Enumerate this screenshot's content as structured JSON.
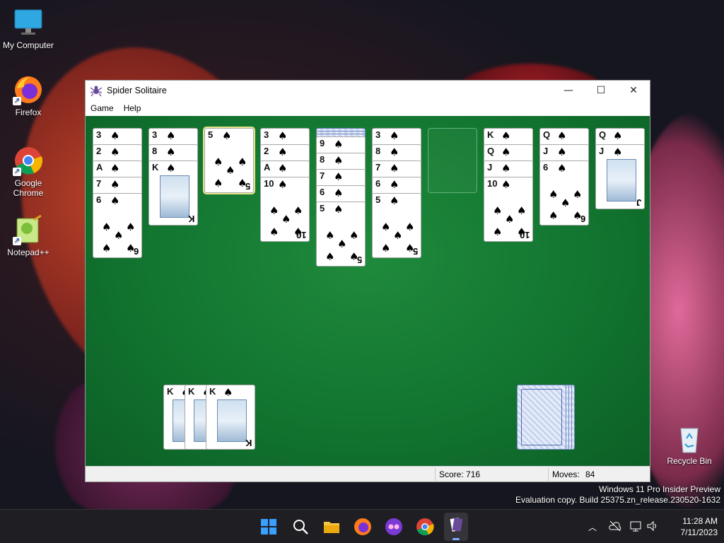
{
  "desktop": {
    "icons": [
      {
        "label": "My Computer"
      },
      {
        "label": "Firefox"
      },
      {
        "label": "Google Chrome"
      },
      {
        "label": "Notepad++"
      },
      {
        "label": "Recycle Bin"
      }
    ]
  },
  "window": {
    "title": "Spider Solitaire",
    "controls": {
      "minimize": "—",
      "maximize": "☐",
      "close": "✕"
    },
    "menu": [
      "Game",
      "Help"
    ],
    "status": {
      "score_label": "Score: 716",
      "moves_label": "Moves:",
      "moves_value": "84"
    }
  },
  "tableau": {
    "suit_symbol": "♠",
    "columns": [
      {
        "cards": [
          "3",
          "2",
          "A",
          "7",
          "6"
        ]
      },
      {
        "cards": [
          "3",
          "8",
          "K"
        ]
      },
      {
        "cards": [
          "5"
        ],
        "selected": true
      },
      {
        "cards": [
          "3",
          "2",
          "A",
          "10"
        ]
      },
      {
        "facedown": 3,
        "cards": [
          "9",
          "8",
          "7",
          "6",
          "5"
        ]
      },
      {
        "cards": [
          "3",
          "8",
          "7",
          "6",
          "5"
        ]
      },
      {
        "cards": [],
        "empty": true
      },
      {
        "cards": [
          "K",
          "Q",
          "J",
          "10"
        ]
      },
      {
        "cards": [
          "Q",
          "J",
          "6"
        ]
      },
      {
        "cards": [
          "Q",
          "J"
        ]
      }
    ],
    "completed_stacks": [
      "K",
      "K",
      "K"
    ],
    "stock_piles": 4
  },
  "watermark": {
    "line1": "Windows 11 Pro Insider Preview",
    "line2": "Evaluation copy. Build 25375.zn_release.230520-1632"
  },
  "taskbar": {
    "time": "11:28 AM",
    "date": "7/11/2023",
    "icons": [
      "start-icon",
      "search-icon",
      "file-explorer-icon",
      "firefox-icon",
      "app-icon",
      "chrome-icon",
      "spider-solitaire-icon"
    ]
  },
  "colors": {
    "felt": "#127530",
    "taskbar": "#1f1f23",
    "card_back": "#6f86bf"
  }
}
